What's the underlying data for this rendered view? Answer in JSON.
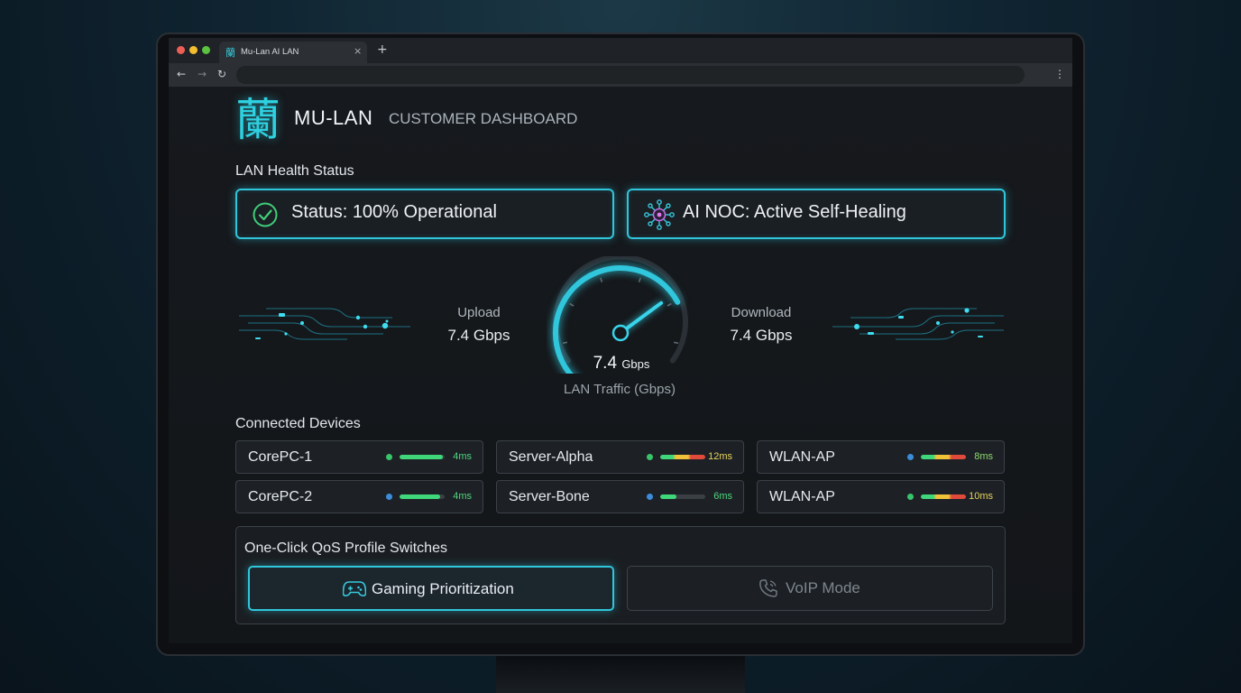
{
  "browser": {
    "tab_title": "Mu-Lan AI LAN",
    "tab_icon_glyph": "蘭",
    "close_glyph": "×",
    "new_tab_glyph": "+"
  },
  "header": {
    "logo_glyph": "蘭",
    "brand": "MU-LAN",
    "subtitle": "CUSTOMER DASHBOARD"
  },
  "health": {
    "section_label": "LAN Health Status",
    "status_text": "Status: 100% Operational",
    "noc_text": "AI NOC: Active Self-Healing"
  },
  "traffic": {
    "upload_label": "Upload",
    "upload_value": "7.4 Gbps",
    "download_label": "Download",
    "download_value": "7.4 Gbps",
    "gauge_number": "7.4",
    "gauge_unit": "Gbps",
    "gauge_label": "LAN Traffic (Gbps)",
    "gauge_level": 0.72
  },
  "devices": {
    "section_label": "Connected Devices",
    "items": [
      {
        "name": "CorePC-1",
        "dot_color": "#39c46a",
        "bar_fill": 0.95,
        "bar_colors": [
          "#3fd77a"
        ],
        "latency": "4ms",
        "latency_color": "#4fd67e"
      },
      {
        "name": "Server-Alpha",
        "dot_color": "#39c46a",
        "bar_fill": 1.0,
        "bar_colors": [
          "#3fd77a",
          "#f0c23a",
          "#e04a3a"
        ],
        "latency": "12ms",
        "latency_color": "#e7d35a"
      },
      {
        "name": "WLAN-AP",
        "dot_color": "#3b8ddb",
        "bar_fill": 1.0,
        "bar_colors": [
          "#3fd77a",
          "#f0c23a",
          "#e04a3a"
        ],
        "latency": "8ms",
        "latency_color": "#8cd86a"
      },
      {
        "name": "CorePC-2",
        "dot_color": "#3b8ddb",
        "bar_fill": 0.9,
        "bar_colors": [
          "#3fd77a"
        ],
        "latency": "4ms",
        "latency_color": "#4fd67e"
      },
      {
        "name": "Server-Bone",
        "dot_color": "#3b8ddb",
        "bar_fill": 0.35,
        "bar_colors": [
          "#3fd77a"
        ],
        "latency": "6ms",
        "latency_color": "#4fd67e"
      },
      {
        "name": "WLAN-AP",
        "dot_color": "#39c46a",
        "bar_fill": 1.0,
        "bar_colors": [
          "#3fd77a",
          "#f0c23a",
          "#e04a3a"
        ],
        "latency": "10ms",
        "latency_color": "#e7d35a"
      }
    ]
  },
  "qos": {
    "title": "One-Click QoS Profile Switches",
    "gaming_label": "Gaming Prioritization",
    "voip_label": "VoIP Mode",
    "active": "Gaming Prioritization"
  },
  "colors": {
    "accent": "#30c6dc",
    "ok": "#39c46a"
  },
  "icons": {
    "status": "check-circle-icon",
    "noc": "neural-network-icon",
    "gaming": "gamepad-icon",
    "voip": "phone-icon"
  }
}
